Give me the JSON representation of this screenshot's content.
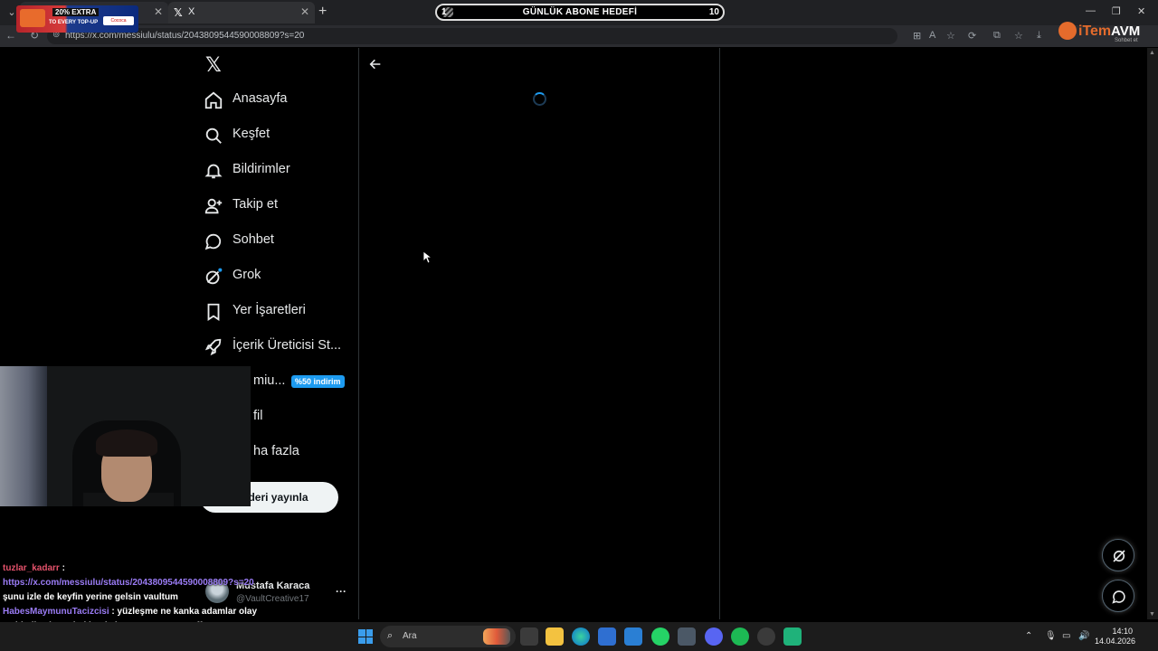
{
  "browser": {
    "tabs": [
      {
        "title": ""
      },
      {
        "title": "X"
      }
    ],
    "url": "https://x.com/messiulu/status/2043809544590008809?s=20",
    "ad": {
      "line1": "20% EXTRA",
      "line2": "TO EVERY TOP-UP",
      "brand": "Cococa"
    }
  },
  "overlay": {
    "goal_title": "GÜNLÜK ABONE HEDEFİ",
    "goal_current": "1",
    "goal_target": "10",
    "goal_progress": 0.1,
    "logo_text_a": "iTem",
    "logo_text_b": "AVM",
    "logo_sub": "Sohbet et"
  },
  "sidebar": {
    "items": [
      {
        "label": "Anasayfa",
        "icon": "home-icon"
      },
      {
        "label": "Keşfet",
        "icon": "search-icon"
      },
      {
        "label": "Bildirimler",
        "icon": "bell-icon"
      },
      {
        "label": "Takip et",
        "icon": "follow-icon"
      },
      {
        "label": "Sohbet",
        "icon": "chat-icon"
      },
      {
        "label": "Grok",
        "icon": "grok-icon"
      },
      {
        "label": "Yer İşaretleri",
        "icon": "bookmark-icon"
      },
      {
        "label": "İçerik Üreticisi St...",
        "icon": "rocket-icon"
      },
      {
        "label": "miu...",
        "icon": "premium-icon"
      },
      {
        "label": "fil",
        "icon": "profile-icon"
      },
      {
        "label": "ha fazla",
        "icon": "more-icon"
      }
    ],
    "premium_badge": "%50 indirim",
    "post_button": "deri yayınla",
    "account": {
      "name": "Mustafa Karaca",
      "handle": "@VaultCreative17",
      "more": "···"
    }
  },
  "chat": [
    {
      "user": "tuzlar_kadarr",
      "link": "https://x.com/messiulu/status/2043809544590008809?s=20",
      "text": "şunu izle de keyfin yerine gelsin vaultum"
    },
    {
      "user": "HabesMaymunuTacizcisi",
      "text": "yüzleşme ne kanka adamlar olay açıldı diye konu hakkında konuşuyor sonra offatreeam konuşalım diyor ne yüz yüzesi"
    }
  ],
  "taskbar": {
    "search_placeholder": "Ara",
    "time": "14:10",
    "date": "14.04.2026"
  },
  "colors": {
    "accent": "#1d9bf0",
    "background": "#000000",
    "text": "#e7e9ea",
    "chat_user1": "#e4526b",
    "chat_user2": "#9b7cf6"
  }
}
